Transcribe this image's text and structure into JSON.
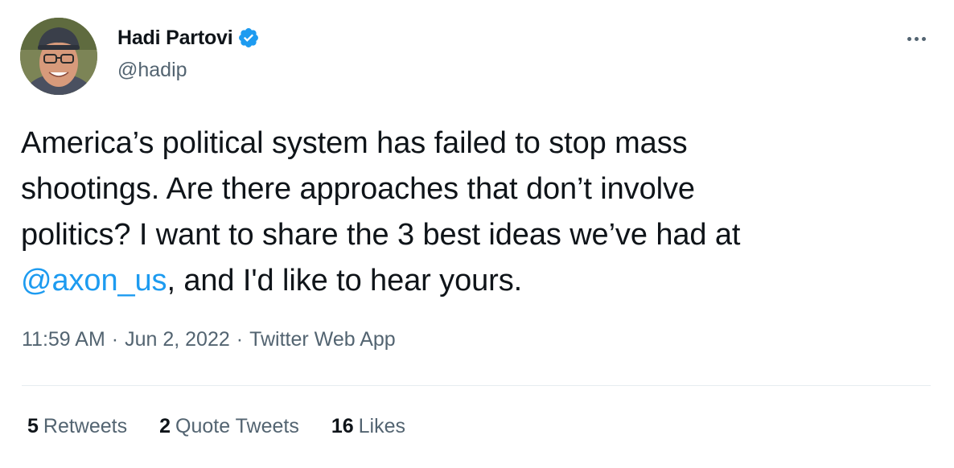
{
  "tweet": {
    "author": {
      "display_name": "Hadi Partovi",
      "handle": "@hadip",
      "verified": true
    },
    "text_lines": [
      "America’s political system has failed to stop mass",
      "shootings. Are there approaches that don’t involve",
      "politics? I want to share the 3 best ideas we’ve had at"
    ],
    "last_line": {
      "mention": "@axon_us",
      "rest": ", and I'd like to hear yours."
    },
    "meta": {
      "time": "11:59 AM",
      "separator": "·",
      "date": "Jun 2, 2022",
      "source": "Twitter Web App"
    },
    "stats": {
      "retweets_count": "5",
      "retweets_label": "Retweets",
      "quotes_count": "2",
      "quotes_label": "Quote Tweets",
      "likes_count": "16",
      "likes_label": "Likes"
    }
  },
  "colors": {
    "text": "#0f1419",
    "secondary": "#536471",
    "link": "#1d9bf0",
    "divider": "#e6ecf0"
  },
  "icons": {
    "verified": "verified-badge-icon",
    "more": "more-options-icon"
  }
}
